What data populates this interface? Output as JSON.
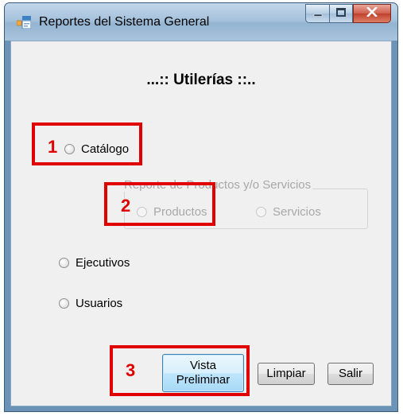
{
  "window": {
    "title": "Reportes del Sistema General",
    "app_icon": "form-app-icon",
    "caption_buttons": [
      "minimize-icon",
      "maximize-icon",
      "close-icon"
    ]
  },
  "content": {
    "heading": "...:: Utilerías ::..",
    "radios": {
      "catalogo": "Catálogo",
      "ejecutivos": "Ejecutivos",
      "usuarios": "Usuarios"
    },
    "group": {
      "legend": "Reporte de Productos y/o Servicios",
      "productos": "Productos",
      "servicios": "Servicios"
    }
  },
  "buttons": {
    "preview": "Vista Preliminar",
    "clear": "Limpiar",
    "exit": "Salir"
  },
  "annotations": {
    "labels": [
      "1",
      "2",
      "3"
    ],
    "color": "#e00000"
  },
  "colors": {
    "window_frame": "#6b93b8",
    "client_bg": "#f0f0f0",
    "disabled_text": "#a8a8a8"
  }
}
